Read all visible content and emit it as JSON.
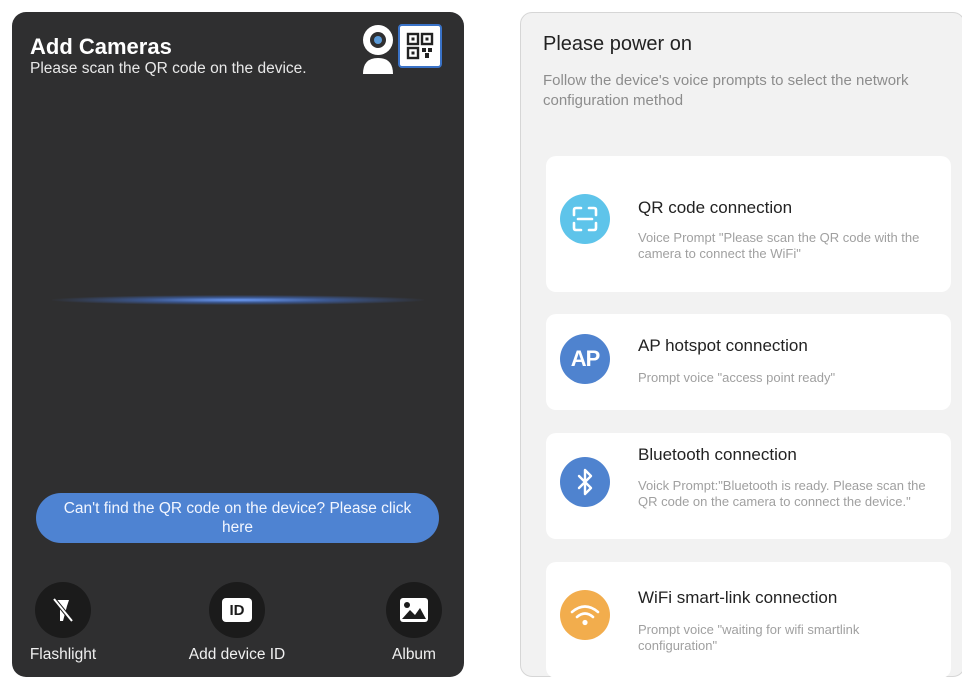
{
  "scanner": {
    "title": "Add Cameras",
    "subtitle": "Please scan the QR code on the device.",
    "help_button": "Can't find the QR code on the device? Please click here",
    "tools": {
      "flashlight": "Flashlight",
      "add_device_id": "Add device ID",
      "add_device_id_icon_text": "ID",
      "album": "Album"
    },
    "colors": {
      "background": "#2f2f30",
      "help_button": "#4e83d2",
      "accent": "#3a73c8"
    }
  },
  "power_on": {
    "title": "Please power on",
    "subtitle": "Follow the device's voice prompts to select the network configuration method",
    "options": [
      {
        "title": "QR code connection",
        "description": "Voice Prompt \"Please scan the QR code with the camera to connect the WiFi\"",
        "icon": "qr-scan-icon",
        "color": "#5ec4ea"
      },
      {
        "title": "AP hotspot connection",
        "description": "Prompt voice \"access point ready\"",
        "icon": "ap-icon",
        "icon_text": "AP",
        "color": "#4f83cf"
      },
      {
        "title": "Bluetooth connection",
        "description": "Voick Prompt:\"Bluetooth is ready. Please scan the QR code on the camera to connect the device.\"",
        "icon": "bluetooth-icon",
        "color": "#4f83cf"
      },
      {
        "title": "WiFi smart-link connection",
        "description": "Prompt voice \"waiting for wifi smartlink configuration\"",
        "icon": "wifi-icon",
        "color": "#f2ad4d"
      }
    ]
  }
}
